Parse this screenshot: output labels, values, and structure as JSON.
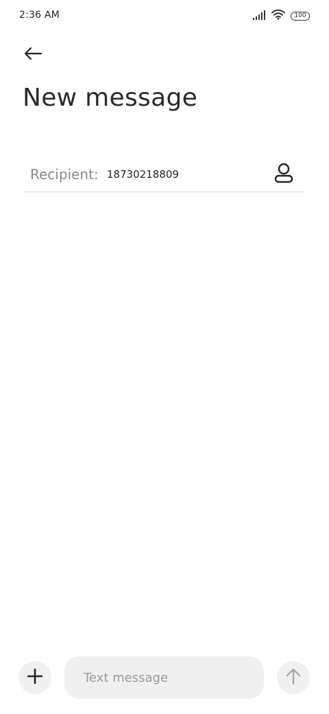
{
  "status_bar": {
    "time": "2:36 AM",
    "battery_level": "100",
    "icons": [
      "signal-icon",
      "wifi-icon",
      "battery-icon"
    ]
  },
  "header": {
    "back_icon": "back-arrow-icon",
    "title": "New message"
  },
  "recipient": {
    "label": "Recipient:",
    "value": "18730218809",
    "contact_icon": "contact-icon"
  },
  "composer": {
    "add_icon": "plus-icon",
    "placeholder": "Text message",
    "value": "",
    "send_icon": "send-arrow-icon"
  },
  "colors": {
    "background": "#ffffff",
    "text": "#222222",
    "muted_text": "#8a8a8a",
    "input_background": "#f0f0f0",
    "divider": "#dcdcdc",
    "send_icon_disabled": "#a8a8a8"
  }
}
